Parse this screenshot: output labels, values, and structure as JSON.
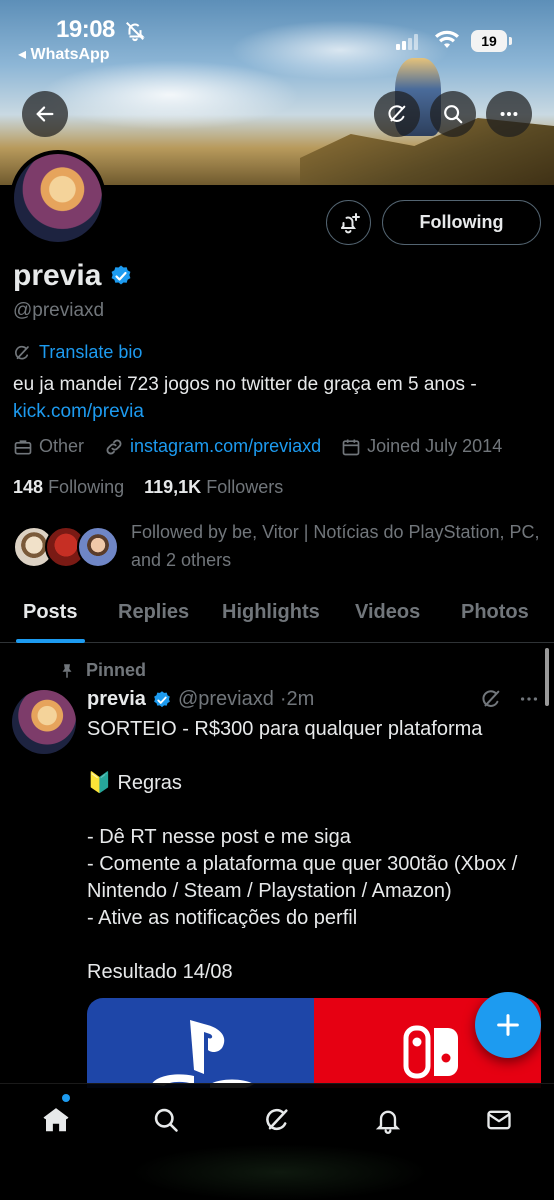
{
  "status_bar": {
    "time": "19:08",
    "back_app": "◂ WhatsApp",
    "battery": "19"
  },
  "header": {
    "back_icon": "arrow-left-icon",
    "grok_icon": "grok-icon",
    "search_icon": "search-icon",
    "more_icon": "more-horizontal-icon"
  },
  "profile": {
    "name": "previa",
    "verified": true,
    "handle": "@previaxd",
    "follow_button": "Following",
    "translate_label": "Translate bio",
    "bio_text": "eu ja mandei 723 jogos no twitter de graça em 5 anos - ",
    "bio_link": "kick.com/previa",
    "category": "Other",
    "website": "instagram.com/previaxd",
    "joined": "Joined July 2014",
    "following_count": "148",
    "following_label": "Following",
    "followers_count": "119,1K",
    "followers_label": "Followers",
    "followed_by": "Followed by be, Vitor | Notícias do PlayStation, PC, and 2 others"
  },
  "tabs": [
    {
      "label": "Posts",
      "active": true
    },
    {
      "label": "Replies",
      "active": false
    },
    {
      "label": "Highlights",
      "active": false
    },
    {
      "label": "Videos",
      "active": false
    },
    {
      "label": "Photos",
      "active": false
    }
  ],
  "post": {
    "pinned_label": "Pinned",
    "author": "previa",
    "handle": "@previaxd",
    "time": "·2m",
    "lines": [
      "SORTEIO - R$300 para qualquer plataforma",
      "",
      "🔰 Regras",
      "",
      "- Dê RT nesse post e me siga",
      "- Comente a plataforma que quer 300tão (Xbox / Nintendo / Steam / Playstation / Amazon)",
      "- Ative as notificações do perfil",
      "",
      "Resultado 14/08"
    ]
  },
  "nav": {
    "items": [
      "home-icon",
      "search-icon",
      "grok-icon",
      "notifications-icon",
      "messages-icon"
    ]
  },
  "colors": {
    "accent": "#1d9bf0",
    "muted": "#71767b",
    "text": "#e7e9ea",
    "background": "#000000"
  }
}
